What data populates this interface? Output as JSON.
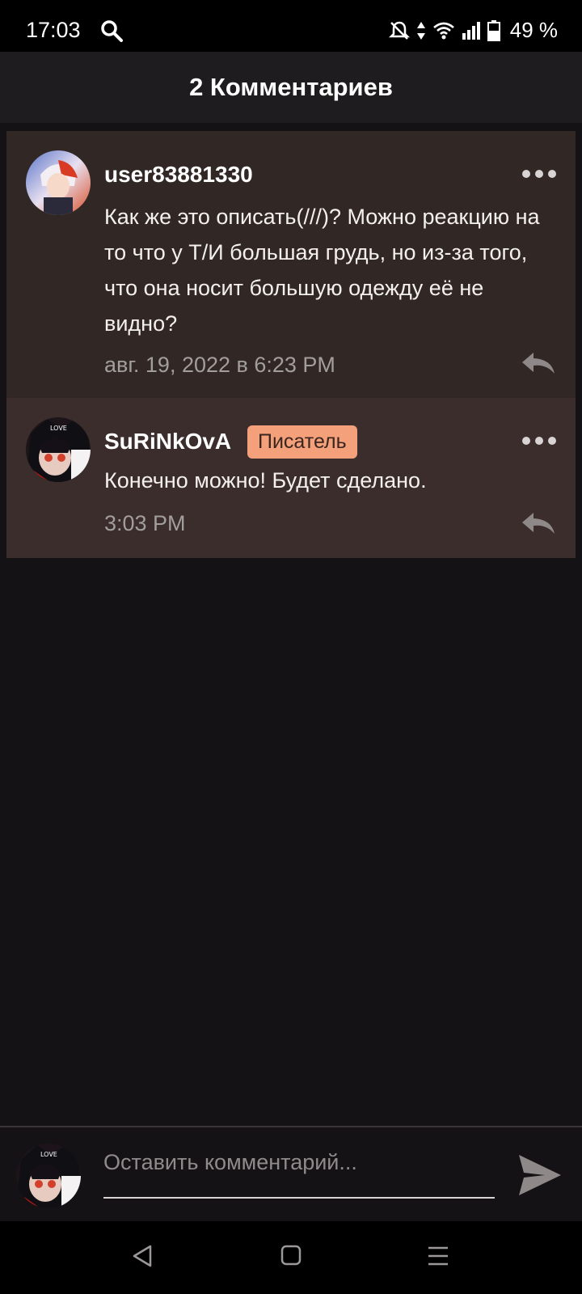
{
  "status_bar": {
    "time": "17:03",
    "battery": "49 %",
    "icons": [
      "search-icon",
      "mute-icon",
      "data-arrows-icon",
      "wifi-icon",
      "signal-icon",
      "battery-icon"
    ]
  },
  "header": {
    "title": "2 Комментариев"
  },
  "comments": [
    {
      "username": "user83881330",
      "text": "Как же это описать(///)? Можно реакцию на то что у Т/И большая грудь, но из-за того, что она носит большую одежду её не видно?",
      "timestamp": "авг. 19, 2022 в 6:23 PM",
      "badge": ""
    },
    {
      "username": "SuRiNkOvA",
      "badge": "Писатель",
      "text": "Конечно можно! Будет сделано.",
      "timestamp": "3:03 PM"
    }
  ],
  "compose": {
    "placeholder": "Оставить комментарий..."
  },
  "colors": {
    "comment_bg_1": "#312825",
    "comment_bg_2": "#3b2d2b",
    "badge_bg": "#f4a07a",
    "page_bg": "#141214"
  }
}
